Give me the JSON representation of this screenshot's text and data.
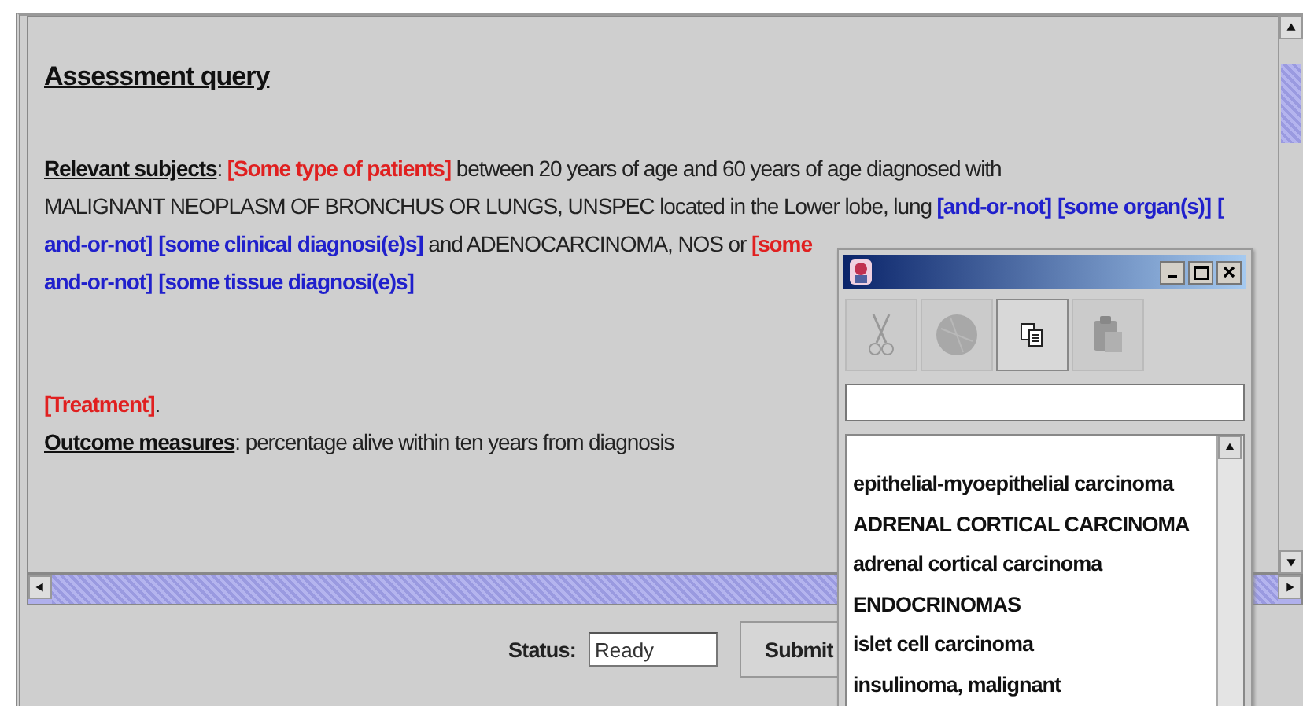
{
  "query": {
    "title": "Assessment query",
    "blocks": [
      {
        "lines": [
          [
            {
              "kind": "label",
              "text": "Relevant subjects"
            },
            {
              "kind": "plain",
              "text": ": "
            },
            {
              "kind": "red",
              "text": "[Some type of patients]"
            },
            {
              "kind": "plain",
              "text": " between 20 years of age and 60 years of age diagnosed with"
            }
          ],
          [
            {
              "kind": "plain",
              "text": "MALIGNANT NEOPLASM OF BRONCHUS OR LUNGS, UNSPEC located in the Lower lobe, lung "
            },
            {
              "kind": "blue",
              "text": "[and-or-not]"
            },
            {
              "kind": "blue",
              "text": "[some organ(s)]"
            },
            {
              "kind": "blue",
              "text": "["
            }
          ],
          [
            {
              "kind": "blue",
              "text": "and-or-not]"
            },
            {
              "kind": "blue",
              "text": "[some clinical diagnosi(e)s]"
            },
            {
              "kind": "plain",
              "text": " and ADENOCARCINOMA, NOS or "
            },
            {
              "kind": "red",
              "text": "[some"
            }
          ],
          [
            {
              "kind": "blue",
              "text": "and-or-not]"
            },
            {
              "kind": "blue",
              "text": "[some tissue diagnosi(e)s]"
            }
          ]
        ]
      },
      {
        "lines": [
          [
            {
              "kind": "red",
              "text": "[Treatment]"
            },
            {
              "kind": "plain",
              "text": "."
            }
          ]
        ]
      },
      {
        "lines": [
          [
            {
              "kind": "label",
              "text": "Outcome measures"
            },
            {
              "kind": "plain",
              "text": ": percentage alive within ten years from diagnosis"
            }
          ]
        ]
      }
    ]
  },
  "status": {
    "label": "Status:",
    "value": "Ready"
  },
  "submit": "Submit",
  "popup": {
    "toolbar": [
      {
        "kind": "cut",
        "disabled": true
      },
      {
        "kind": "ball",
        "disabled": true
      },
      {
        "kind": "copy",
        "disabled": false
      },
      {
        "kind": "paste",
        "disabled": true
      }
    ],
    "items": [
      "epithelial-myoepithelial carcinoma",
      "ADRENAL CORTICAL CARCINOMA",
      "adrenal cortical carcinoma",
      "ENDOCRINOMAS",
      "islet cell carcinoma",
      "insulinoma, malignant"
    ]
  }
}
